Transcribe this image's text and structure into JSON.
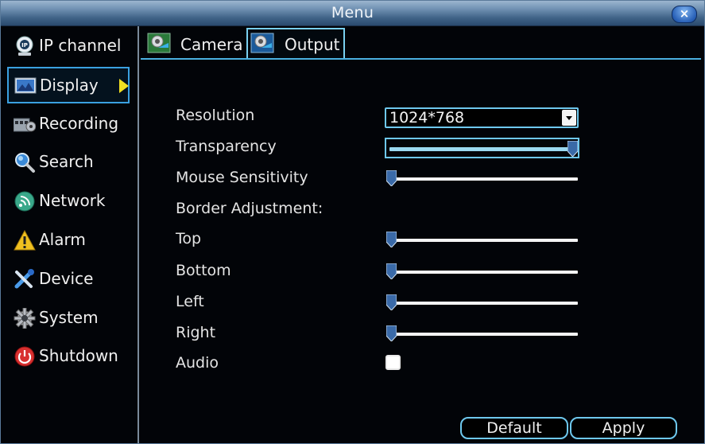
{
  "window": {
    "title": "Menu",
    "close_label": "×"
  },
  "sidebar": {
    "items": [
      {
        "label": "IP channel",
        "icon": "ip-camera-icon"
      },
      {
        "label": "Display",
        "icon": "display-icon",
        "active": true
      },
      {
        "label": "Recording",
        "icon": "film-recording-icon"
      },
      {
        "label": "Search",
        "icon": "magnifier-icon"
      },
      {
        "label": "Network",
        "icon": "network-icon"
      },
      {
        "label": "Alarm",
        "icon": "warning-icon"
      },
      {
        "label": "Device",
        "icon": "tools-icon"
      },
      {
        "label": "System",
        "icon": "gear-icon"
      },
      {
        "label": "Shutdown",
        "icon": "power-icon"
      }
    ]
  },
  "tabs": [
    {
      "label": "Camera",
      "icon": "camera-settings-icon"
    },
    {
      "label": "Output",
      "icon": "output-settings-icon",
      "active": true
    }
  ],
  "form": {
    "resolution_label": "Resolution",
    "resolution_value": "1024*768",
    "transparency_label": "Transparency",
    "transparency_level": 1.0,
    "mouse_sensitivity_label": "Mouse Sensitivity",
    "mouse_sensitivity_level": 0.0,
    "border_adjustment_label": "Border Adjustment:",
    "top_label": "Top",
    "top_level": 0.0,
    "bottom_label": "Bottom",
    "bottom_level": 0.0,
    "left_label": "Left",
    "left_level": 0.0,
    "right_label": "Right",
    "right_level": 0.0,
    "audio_label": "Audio",
    "audio_checked": false
  },
  "buttons": {
    "default_label": "Default",
    "apply_label": "Apply"
  },
  "colors": {
    "accent": "#6ec8ee",
    "active_arrow": "#f0e020",
    "title_bar": "#4f7398"
  }
}
